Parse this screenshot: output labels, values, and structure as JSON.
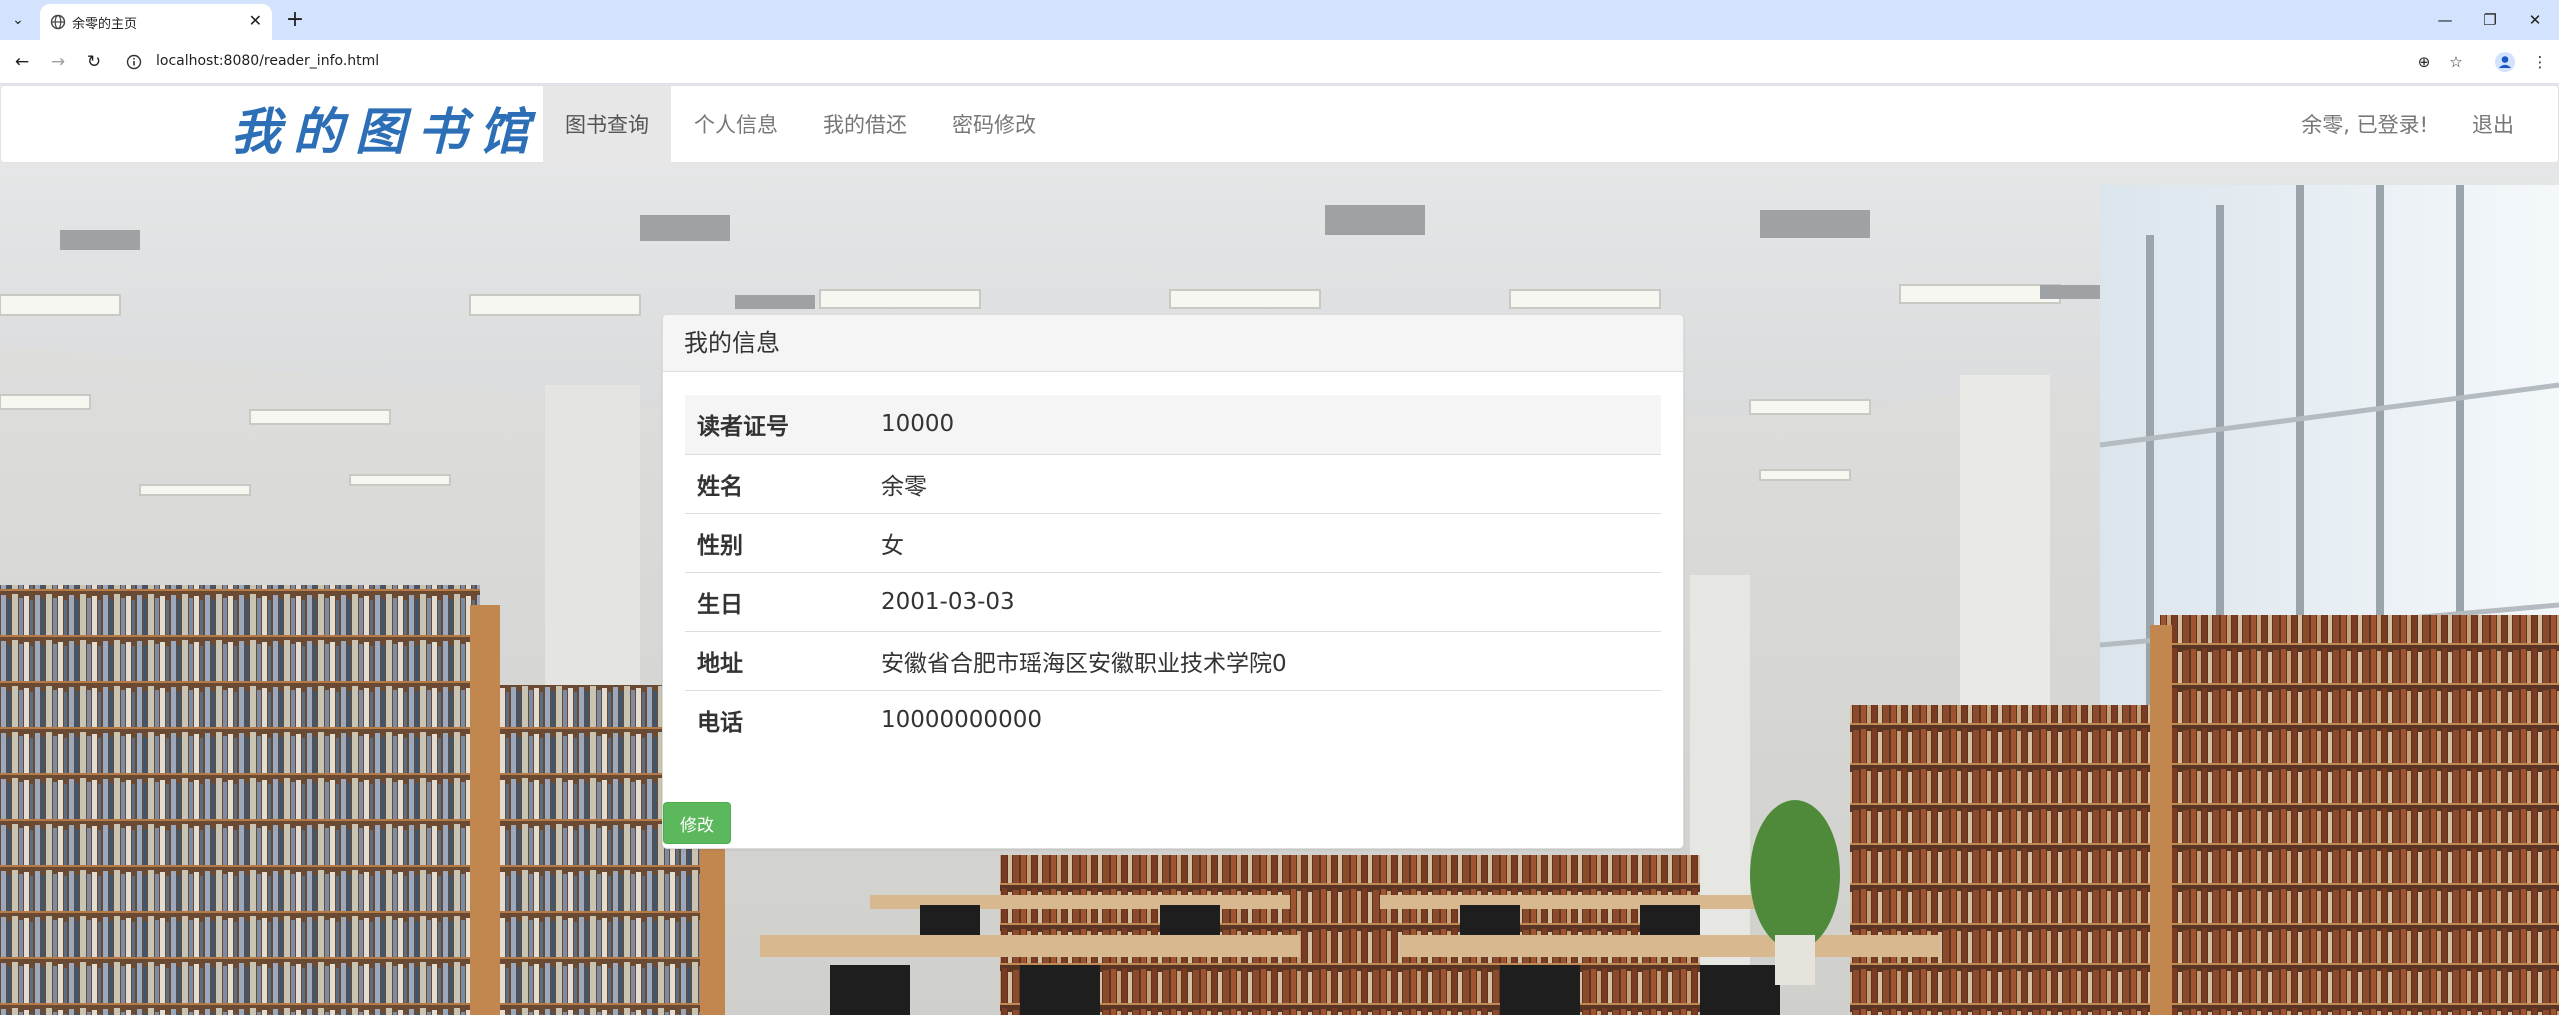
{
  "browser": {
    "tab_title": "余零的主页",
    "url": "localhost:8080/reader_info.html"
  },
  "navbar": {
    "brand": "我的图书馆",
    "items": [
      {
        "label": "图书查询",
        "active": true
      },
      {
        "label": "个人信息",
        "active": false
      },
      {
        "label": "我的借还",
        "active": false
      },
      {
        "label": "密码修改",
        "active": false
      }
    ],
    "user_status": "余零, 已登录!",
    "logout_label": "退出"
  },
  "panel": {
    "title": "我的信息",
    "rows": [
      {
        "label": "读者证号",
        "value": "10000"
      },
      {
        "label": "姓名",
        "value": "余零"
      },
      {
        "label": "性别",
        "value": "女"
      },
      {
        "label": "生日",
        "value": "2001-03-03"
      },
      {
        "label": "地址",
        "value": "安徽省合肥市瑶海区安徽职业技术学院0"
      },
      {
        "label": "电话",
        "value": "10000000000"
      }
    ],
    "edit_button": "修改"
  },
  "colors": {
    "brand": "#2c6fb7",
    "button_success": "#5cb85c",
    "nav_active_bg": "#e7e7e7",
    "chrome_tabbar": "#d3e3fd"
  }
}
